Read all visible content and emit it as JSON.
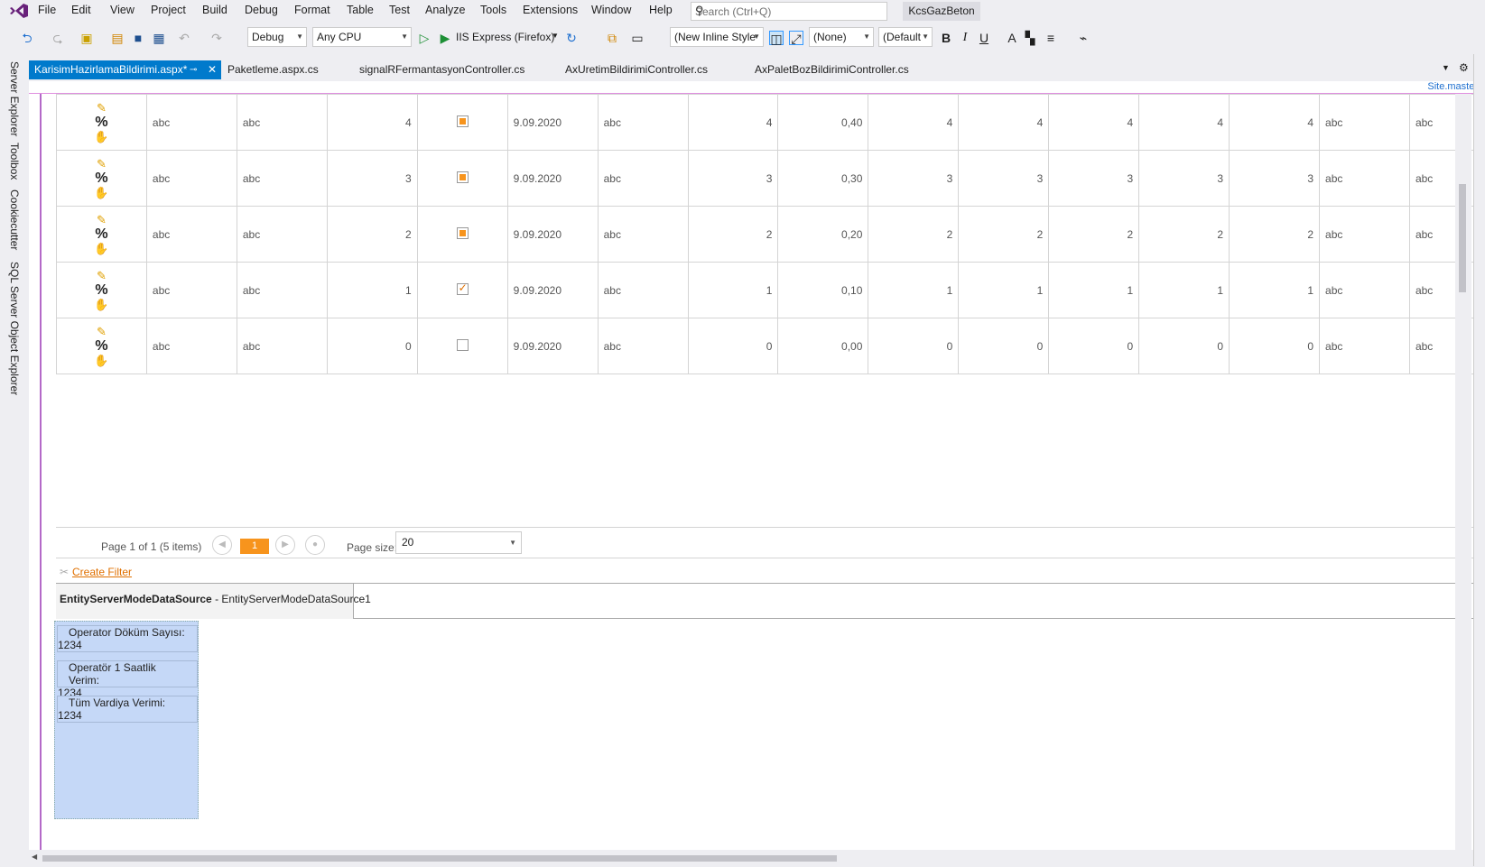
{
  "menu": [
    "File",
    "Edit",
    "View",
    "Project",
    "Build",
    "Debug",
    "Format",
    "Table",
    "Test",
    "Analyze",
    "Tools",
    "Extensions",
    "Window",
    "Help"
  ],
  "search": {
    "placeholder": "Search (Ctrl+Q)"
  },
  "solution_name": "KcsGazBeton",
  "toolbar": {
    "config": "Debug",
    "platform": "Any CPU",
    "run_target": "IIS Express (Firefox)",
    "style_combo": "(New Inline Style",
    "class_combo": "(None)",
    "font_combo": "(Default",
    "bold": "B",
    "italic": "I",
    "underline": "U"
  },
  "tabs": [
    {
      "label": "KarisimHazirlamaBildirimi.aspx*",
      "active": true
    },
    {
      "label": "Paketleme.aspx.cs"
    },
    {
      "label": "signalRFermantasyonController.cs"
    },
    {
      "label": "AxUretimBildirimiController.cs"
    },
    {
      "label": "AxPaletBozBildirimiController.cs"
    }
  ],
  "side_tabs": [
    "Server Explorer",
    "Toolbox",
    "Cookiecutter",
    "SQL Server Object Explorer"
  ],
  "site_master": "Site.master",
  "grid": {
    "rows": [
      {
        "c1": "abc",
        "c2": "abc",
        "n1": "4",
        "check": "ind",
        "date": "9.09.2020",
        "c3": "abc",
        "n2": "4",
        "dec": "0,40",
        "n3": "4",
        "n4": "4",
        "n5": "4",
        "n6": "4",
        "n7": "4",
        "c4": "abc",
        "c5": "abc"
      },
      {
        "c1": "abc",
        "c2": "abc",
        "n1": "3",
        "check": "ind",
        "date": "9.09.2020",
        "c3": "abc",
        "n2": "3",
        "dec": "0,30",
        "n3": "3",
        "n4": "3",
        "n5": "3",
        "n6": "3",
        "n7": "3",
        "c4": "abc",
        "c5": "abc"
      },
      {
        "c1": "abc",
        "c2": "abc",
        "n1": "2",
        "check": "ind",
        "date": "9.09.2020",
        "c3": "abc",
        "n2": "2",
        "dec": "0,20",
        "n3": "2",
        "n4": "2",
        "n5": "2",
        "n6": "2",
        "n7": "2",
        "c4": "abc",
        "c5": "abc"
      },
      {
        "c1": "abc",
        "c2": "abc",
        "n1": "1",
        "check": "checked",
        "date": "9.09.2020",
        "c3": "abc",
        "n2": "1",
        "dec": "0,10",
        "n3": "1",
        "n4": "1",
        "n5": "1",
        "n6": "1",
        "n7": "1",
        "c4": "abc",
        "c5": "abc"
      },
      {
        "c1": "abc",
        "c2": "abc",
        "n1": "0",
        "check": "empty",
        "date": "9.09.2020",
        "c3": "abc",
        "n2": "0",
        "dec": "0,00",
        "n3": "0",
        "n4": "0",
        "n5": "0",
        "n6": "0",
        "n7": "0",
        "c4": "abc",
        "c5": "abc"
      }
    ]
  },
  "pager": {
    "summary": "Page 1 of 1 (5 items)",
    "current": "1",
    "size_label": "Page size:",
    "size_value": "20"
  },
  "filter": {
    "label": "Create Filter"
  },
  "datasource": {
    "type": "EntityServerModeDataSource",
    "sep": " - ",
    "id": "EntityServerModeDataSource1"
  },
  "info": [
    {
      "label": "Operator Döküm Sayısı:",
      "value": "1234"
    },
    {
      "label": "Operatör 1 Saatlik Verim:",
      "value": "1234"
    },
    {
      "label": "Tüm Vardiya Verimi:",
      "value": "1234"
    }
  ],
  "colors": {
    "accent": "#007acc",
    "orange": "#f7941d",
    "purple": "#b469c8",
    "panel_blue": "#c5d8f7"
  }
}
